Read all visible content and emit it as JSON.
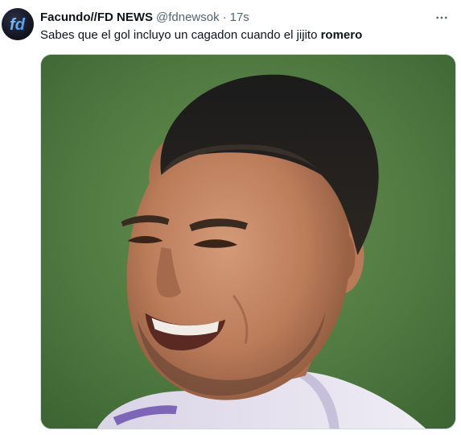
{
  "tweet": {
    "display_name": "Facundo//FD NEWS",
    "handle": "@fdnewsok",
    "separator": "·",
    "time": "17s",
    "text_main": "Sabes que el gol incluyo un cagadon cuando el jijito ",
    "text_bold": "romero",
    "avatar_logo": "fd",
    "more_icon": "more-horizontal-icon"
  },
  "colors": {
    "name": "#0f1419",
    "secondary": "#536471",
    "border": "#cfd9de",
    "avatar_bg": "#11131c",
    "avatar_logo": "#5aa9f2"
  }
}
